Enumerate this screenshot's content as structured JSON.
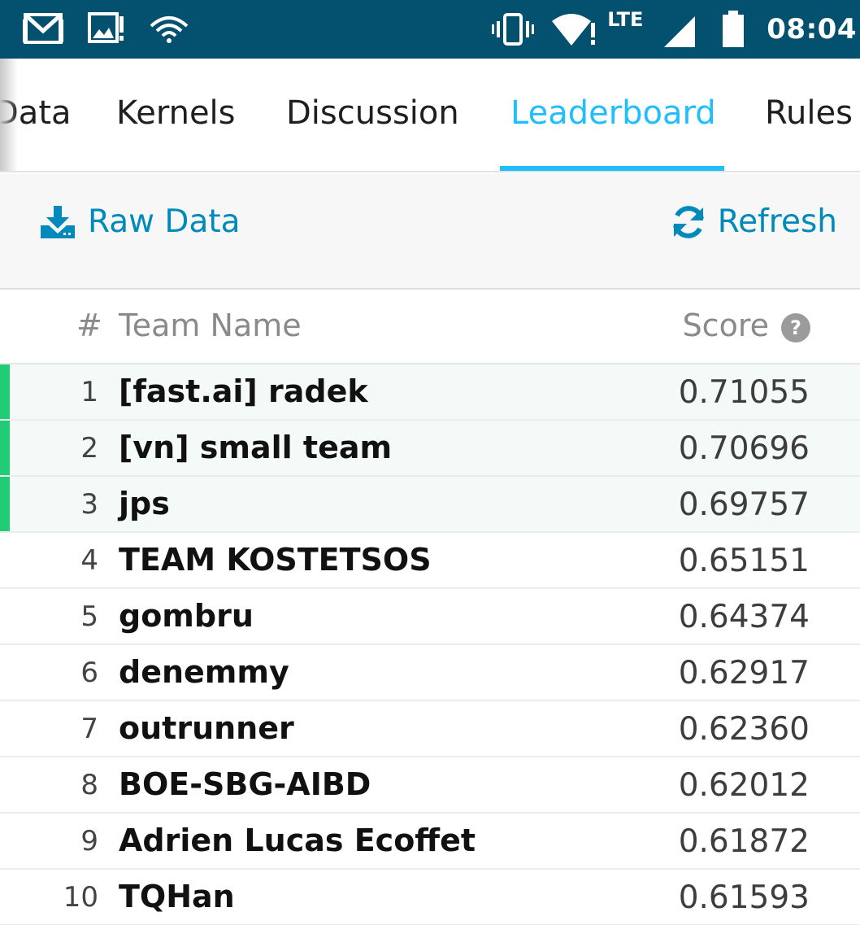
{
  "status_bar": {
    "time": "08:04",
    "network": "LTE",
    "icons": [
      "gmail-icon",
      "image-alert-icon",
      "wifi-icon",
      "vibrate-icon",
      "wifi-alert-icon",
      "signal-icon",
      "battery-icon"
    ]
  },
  "tabs": [
    {
      "label": "Data",
      "active": false
    },
    {
      "label": "Kernels",
      "active": false
    },
    {
      "label": "Discussion",
      "active": false
    },
    {
      "label": "Leaderboard",
      "active": true
    },
    {
      "label": "Rules",
      "active": false
    }
  ],
  "toolbar": {
    "raw_data_label": "Raw Data",
    "refresh_label": "Refresh"
  },
  "leaderboard": {
    "columns": {
      "rank": "#",
      "team": "Team Name",
      "score": "Score"
    },
    "rows": [
      {
        "rank": "1",
        "team": "[fast.ai] radek",
        "score": "0.71055",
        "medal": true
      },
      {
        "rank": "2",
        "team": "[vn] small team",
        "score": "0.70696",
        "medal": true
      },
      {
        "rank": "3",
        "team": "jps",
        "score": "0.69757",
        "medal": true
      },
      {
        "rank": "4",
        "team": "TEAM KOSTETSOS",
        "score": "0.65151",
        "medal": false
      },
      {
        "rank": "5",
        "team": "gombru",
        "score": "0.64374",
        "medal": false
      },
      {
        "rank": "6",
        "team": "denemmy",
        "score": "0.62917",
        "medal": false
      },
      {
        "rank": "7",
        "team": "outrunner",
        "score": "0.62360",
        "medal": false
      },
      {
        "rank": "8",
        "team": "BOE-SBG-AIBD",
        "score": "0.62012",
        "medal": false
      },
      {
        "rank": "9",
        "team": "Adrien Lucas Ecoffet",
        "score": "0.61872",
        "medal": false
      },
      {
        "rank": "10",
        "team": "TQHan",
        "score": "0.61593",
        "medal": false
      }
    ]
  },
  "colors": {
    "status_bar": "#04506f",
    "accent": "#20beff",
    "link": "#008abc",
    "medal": "#20cc75"
  }
}
